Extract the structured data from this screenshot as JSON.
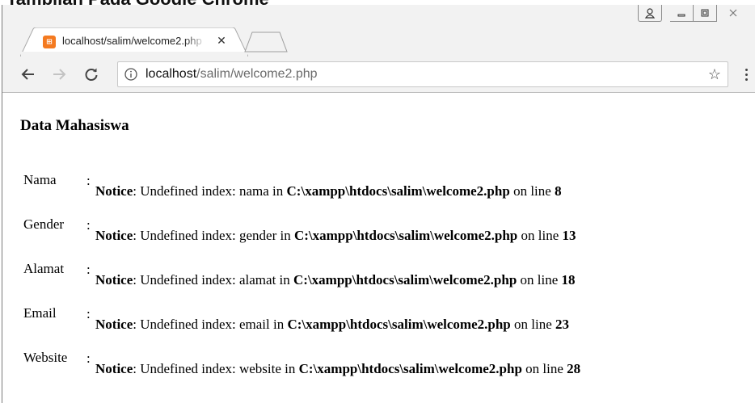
{
  "top_caption": "Tampilan Pada Google Chrome",
  "browser": {
    "tab": {
      "title": "localhost/salim/welcome2.php",
      "favicon_glyph": "⊞",
      "favicon_color": "#f47a20",
      "close_glyph": "✕"
    },
    "window_controls": {
      "profile_glyph": "♌",
      "minimize_glyph": "–",
      "maximize_glyph": "□",
      "close_glyph": "✕"
    },
    "toolbar": {
      "back_icon": "arrow-left-icon",
      "forward_icon": "arrow-right-icon",
      "reload_icon": "reload-icon",
      "url_host": "localhost",
      "url_path": "/salim/welcome2.php",
      "bookmark_glyph": "☆",
      "menu_icon": "kebab-menu-icon"
    }
  },
  "page": {
    "heading": "Data Mahasiswa",
    "colon": ":",
    "rows": [
      {
        "label": "Nama",
        "notice": "Notice",
        "text": ": Undefined index: nama in ",
        "path": "C:\\xampp\\htdocs\\salim\\welcome2.php",
        "on_line": " on line ",
        "line": "8"
      },
      {
        "label": "Gender",
        "notice": "Notice",
        "text": ": Undefined index: gender in ",
        "path": "C:\\xampp\\htdocs\\salim\\welcome2.php",
        "on_line": " on line ",
        "line": "13"
      },
      {
        "label": "Alamat",
        "notice": "Notice",
        "text": ": Undefined index: alamat in ",
        "path": "C:\\xampp\\htdocs\\salim\\welcome2.php",
        "on_line": " on line ",
        "line": "18"
      },
      {
        "label": "Email",
        "notice": "Notice",
        "text": ": Undefined index: email in ",
        "path": "C:\\xampp\\htdocs\\salim\\welcome2.php",
        "on_line": " on line ",
        "line": "23"
      },
      {
        "label": "Website",
        "notice": "Notice",
        "text": ": Undefined index: website in ",
        "path": "C:\\xampp\\htdocs\\salim\\welcome2.php",
        "on_line": " on line ",
        "line": "28"
      }
    ]
  }
}
